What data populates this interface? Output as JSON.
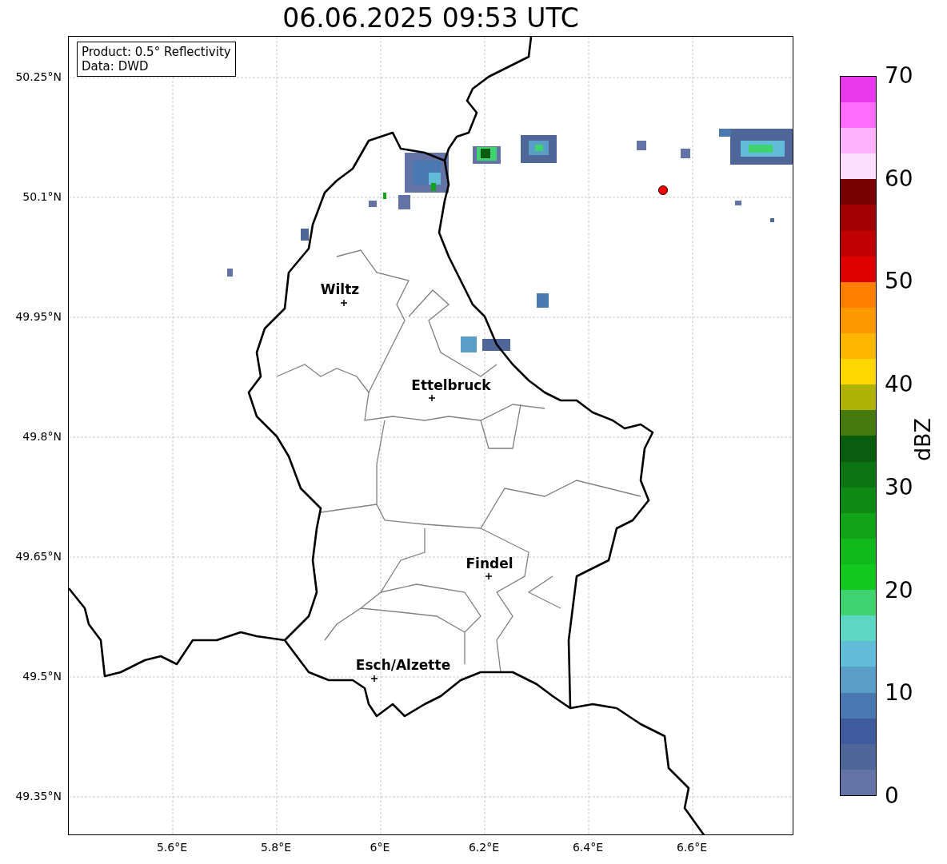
{
  "title": "06.06.2025 09:53 UTC",
  "info_box": {
    "lines": [
      "Product: 0.5° Reflectivity",
      "Data: DWD"
    ]
  },
  "y_ticks": [
    "50.25°N",
    "50.1°N",
    "49.95°N",
    "49.8°N",
    "49.65°N",
    "49.5°N",
    "49.35°N"
  ],
  "x_ticks": [
    "5.6°E",
    "5.8°E",
    "6°E",
    "6.2°E",
    "6.4°E",
    "6.6°E"
  ],
  "cities": [
    "Wiltz",
    "Ettelbruck",
    "Findel",
    "Esch/Alzette"
  ],
  "colorbar": {
    "label": "dBZ",
    "ticks": [
      "70",
      "60",
      "50",
      "40",
      "30",
      "20",
      "10",
      "0"
    ],
    "bins": [
      {
        "color": "#6373a6"
      },
      {
        "color": "#4f6698"
      },
      {
        "color": "#405a9e"
      },
      {
        "color": "#4a78b0"
      },
      {
        "color": "#5a9ec8"
      },
      {
        "color": "#62bcd8"
      },
      {
        "color": "#5ed6c4"
      },
      {
        "color": "#3ed36e"
      },
      {
        "color": "#12c81e"
      },
      {
        "color": "#10b81c"
      },
      {
        "color": "#12a418"
      },
      {
        "color": "#0e8a14"
      },
      {
        "color": "#0c7412"
      },
      {
        "color": "#0a5c0e"
      },
      {
        "color": "#467a0e"
      },
      {
        "color": "#b0b208"
      },
      {
        "color": "#fed700"
      },
      {
        "color": "#feb700"
      },
      {
        "color": "#fe9800"
      },
      {
        "color": "#fe7e00"
      },
      {
        "color": "#e00000"
      },
      {
        "color": "#c00000"
      },
      {
        "color": "#a00000"
      },
      {
        "color": "#780000"
      },
      {
        "color": "#ffdfff"
      },
      {
        "color": "#ffb3ff"
      },
      {
        "color": "#ff6aff"
      },
      {
        "color": "#e838ec"
      }
    ]
  }
}
